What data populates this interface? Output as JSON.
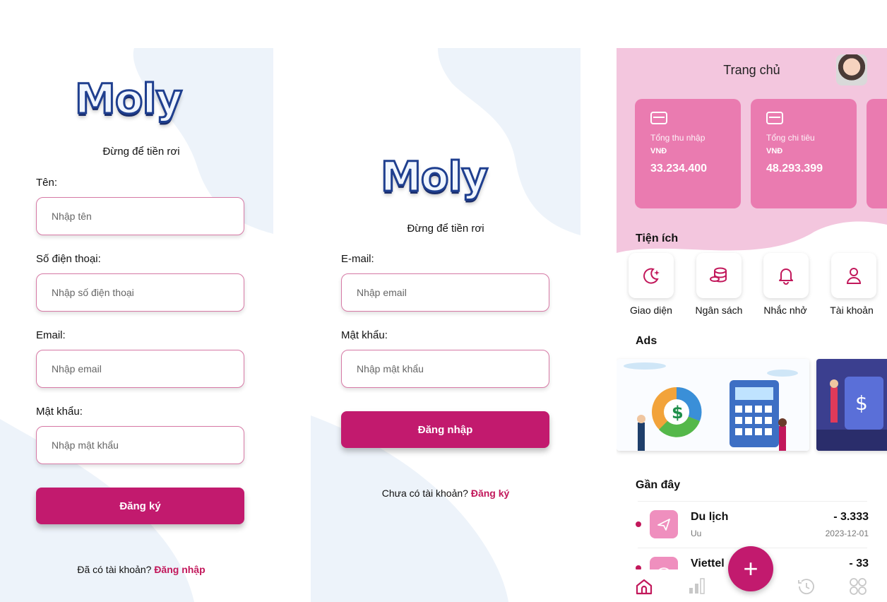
{
  "register": {
    "logo": "Moly",
    "tagline": "Đừng để tiền rơi",
    "name_label": "Tên:",
    "name_placeholder": "Nhập tên",
    "phone_label": "Số điện thoại:",
    "phone_placeholder": "Nhập số điện thoại",
    "email_label": "Email:",
    "email_placeholder": "Nhập email",
    "password_label": "Mật khẩu:",
    "password_placeholder": "Nhập mật khẩu",
    "submit_label": "Đăng ký",
    "switch_text": "Đã có tài khoản?",
    "switch_link": "Đăng nhập"
  },
  "login": {
    "logo": "Moly",
    "tagline": "Đừng để tiền rơi",
    "email_label": "E-mail:",
    "email_placeholder": "Nhập email",
    "password_label": "Mật khẩu:",
    "password_placeholder": "Nhập mật khẩu",
    "submit_label": "Đăng nhập",
    "switch_text": "Chưa có tài khoản?",
    "switch_link": "Đăng ký"
  },
  "home": {
    "title": "Trang chủ",
    "cards": [
      {
        "title": "Tổng thu nhập",
        "currency": "VNĐ",
        "value": "33.234.400"
      },
      {
        "title": "Tổng chi tiêu",
        "currency": "VNĐ",
        "value": "48.293.399"
      }
    ],
    "utilities_title": "Tiện ích",
    "utilities": [
      {
        "label": "Giao diện",
        "icon": "theme-icon"
      },
      {
        "label": "Ngân sách",
        "icon": "coins-icon"
      },
      {
        "label": "Nhắc nhở",
        "icon": "bell-icon"
      },
      {
        "label": "Tài khoản",
        "icon": "user-icon"
      }
    ],
    "ads_title": "Ads",
    "recent_title": "Gần đây",
    "transactions": [
      {
        "name": "Du lịch",
        "note": "Uu",
        "amount": "- 3.333",
        "date": "2023-12-01",
        "icon": "plane-icon"
      },
      {
        "name": "Viettel",
        "amount": "- 33",
        "icon": "wifi-icon"
      }
    ],
    "fab_label": "+",
    "nav": [
      "home-icon",
      "stats-icon",
      "history-icon",
      "grid-icon"
    ],
    "colors": {
      "accent": "#c21a6e",
      "header": "#f3c6de",
      "card": "#ea7bb0"
    }
  }
}
